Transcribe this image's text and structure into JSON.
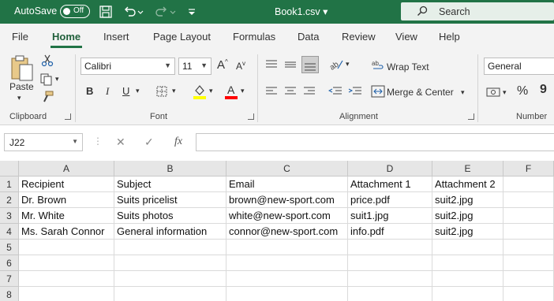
{
  "titlebar": {
    "autosave_label": "AutoSave",
    "autosave_state": "Off",
    "filename": "Book1.csv",
    "search_placeholder": "Search"
  },
  "tabs": [
    "File",
    "Home",
    "Insert",
    "Page Layout",
    "Formulas",
    "Data",
    "Review",
    "View",
    "Help"
  ],
  "active_tab": "Home",
  "ribbon": {
    "clipboard": {
      "paste_label": "Paste",
      "group_label": "Clipboard"
    },
    "font": {
      "font_name": "Calibri",
      "font_size": "11",
      "group_label": "Font",
      "grow": "A",
      "shrink": "A",
      "bold": "B",
      "italic": "I",
      "underline": "U"
    },
    "alignment": {
      "wrap_text": "Wrap Text",
      "merge_center": "Merge & Center",
      "group_label": "Alignment"
    },
    "number": {
      "format": "General",
      "group_label": "Number",
      "percent": "%",
      "comma": "9"
    }
  },
  "formula_bar": {
    "name_box": "J22",
    "fx": "fx",
    "value": ""
  },
  "grid": {
    "columns": [
      "A",
      "B",
      "C",
      "D",
      "E",
      "F"
    ],
    "rows": [
      "1",
      "2",
      "3",
      "4",
      "5",
      "6",
      "7",
      "8"
    ],
    "cells": [
      [
        "Recipient",
        "Subject",
        "Email",
        "Attachment  1",
        "Attachment  2",
        ""
      ],
      [
        "Dr. Brown",
        "Suits pricelist",
        "brown@new-sport.com",
        "price.pdf",
        "suit2.jpg",
        ""
      ],
      [
        "Mr. White",
        "Suits photos",
        "white@new-sport.com",
        "suit1.jpg",
        "suit2.jpg",
        ""
      ],
      [
        "Ms. Sarah Connor",
        "General information",
        "connor@new-sport.com",
        "info.pdf",
        "suit2.jpg",
        ""
      ],
      [
        "",
        "",
        "",
        "",
        "",
        ""
      ],
      [
        "",
        "",
        "",
        "",
        "",
        ""
      ],
      [
        "",
        "",
        "",
        "",
        "",
        ""
      ],
      [
        "",
        "",
        "",
        "",
        "",
        ""
      ]
    ]
  },
  "colors": {
    "accent": "#217346",
    "highlight": "#ffff00",
    "font_color": "#ff0000"
  }
}
